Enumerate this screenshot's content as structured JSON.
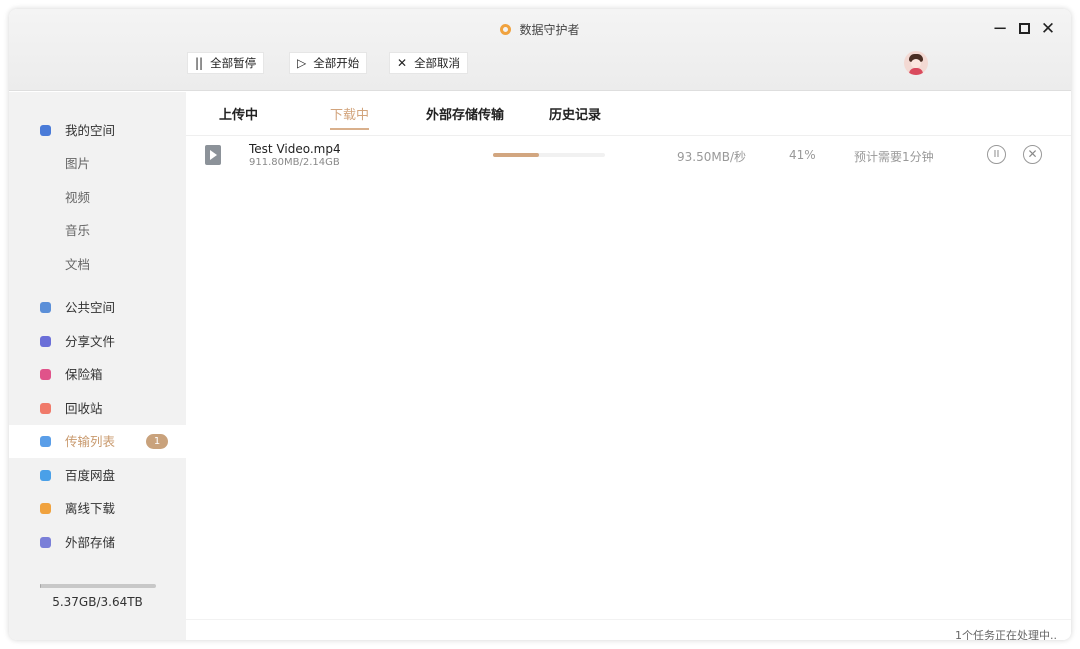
{
  "window": {
    "title": "数据守护者",
    "controls": {
      "minimize": "−",
      "maximize": "",
      "close": "✕"
    }
  },
  "toolbar": {
    "pause_all": {
      "icon": "||",
      "label": "全部暂停"
    },
    "start_all": {
      "icon": "▷",
      "label": "全部开始"
    },
    "cancel_all": {
      "icon": "✕",
      "label": "全部取消"
    }
  },
  "sidebar": {
    "items": [
      {
        "label": "我的空间",
        "icon": "my-space-icon",
        "color": "#4a7bd8"
      },
      {
        "label": "图片",
        "sub": true
      },
      {
        "label": "视频",
        "sub": true
      },
      {
        "label": "音乐",
        "sub": true
      },
      {
        "label": "文档",
        "sub": true
      },
      {
        "label": "公共空间",
        "icon": "public-space-icon",
        "color": "#5b8fd8"
      },
      {
        "label": "分享文件",
        "icon": "share-icon",
        "color": "#6b6fd8"
      },
      {
        "label": "保险箱",
        "icon": "safe-icon",
        "color": "#e0538a"
      },
      {
        "label": "回收站",
        "icon": "trash-icon",
        "color": "#f07a6a"
      },
      {
        "label": "传输列表",
        "icon": "transfer-icon",
        "color": "#5a9ee8",
        "active": true,
        "badge": "1"
      },
      {
        "label": "百度网盘",
        "icon": "baidu-pan-icon",
        "color": "#4aa0e8"
      },
      {
        "label": "离线下载",
        "icon": "offline-download-icon",
        "color": "#f0a23e"
      },
      {
        "label": "外部存储",
        "icon": "external-storage-icon",
        "color": "#7a7fd8"
      }
    ],
    "storage": {
      "text": "5.37GB/3.64TB",
      "used_fraction": 0.0015
    }
  },
  "tabs": [
    {
      "label": "上传中"
    },
    {
      "label": "下载中",
      "active": true
    },
    {
      "label": "外部存储传输"
    },
    {
      "label": "历史记录"
    }
  ],
  "transfers": [
    {
      "name": "Test Video.mp4",
      "size": "911.80MB/2.14GB",
      "progress": 0.41,
      "speed": "93.50MB/秒",
      "percent": "41%",
      "eta": "预计需要1分钟"
    }
  ],
  "status": "1个任务正在处理中.."
}
